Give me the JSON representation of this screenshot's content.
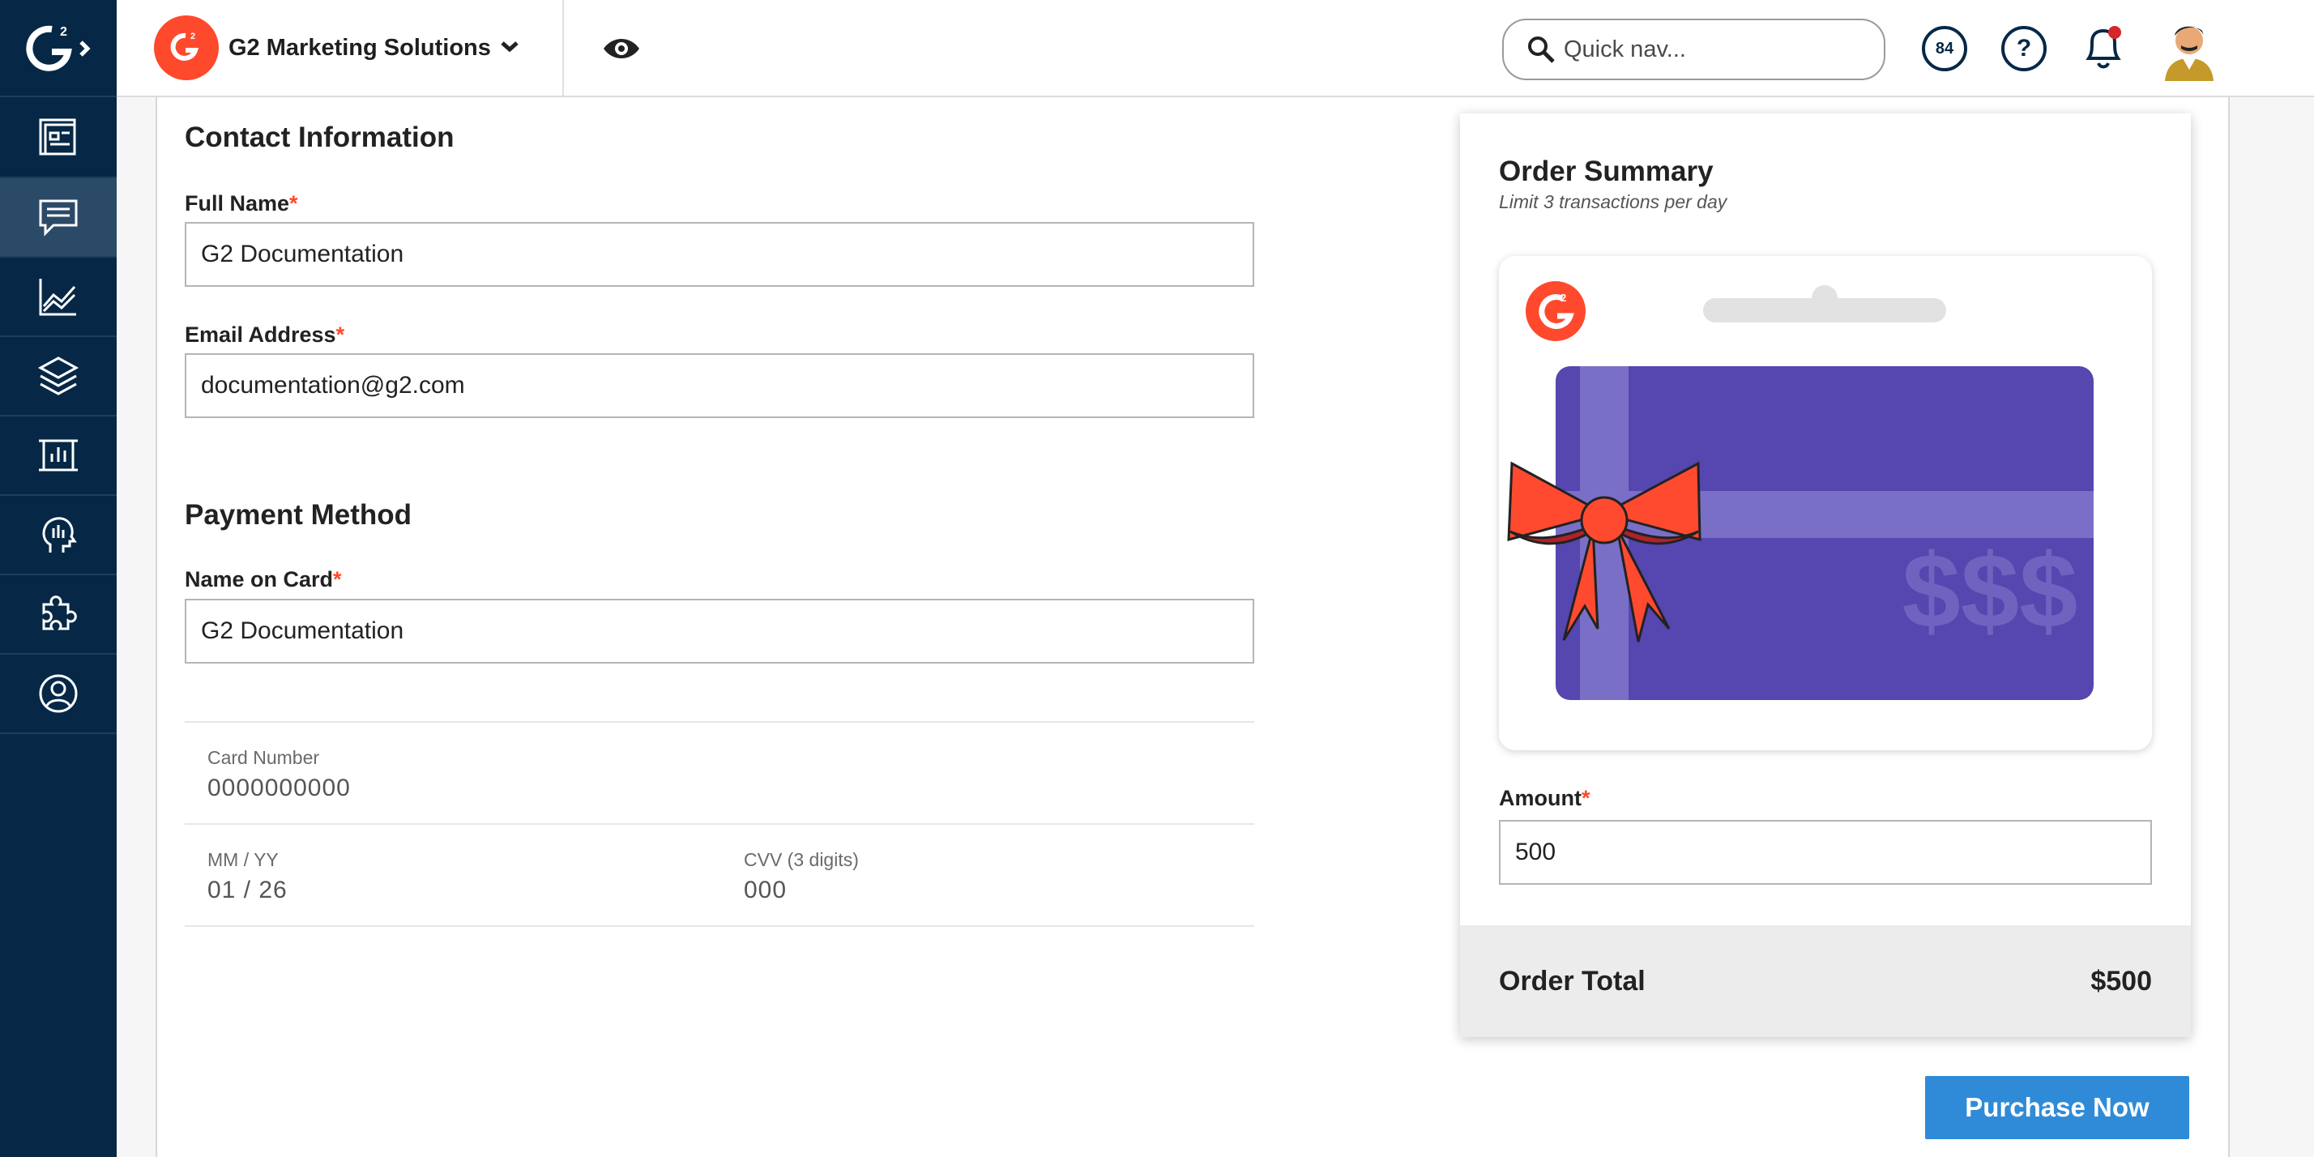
{
  "brand": {
    "accent": "#ff492c",
    "navy": "#062846",
    "button_blue": "#2f8bd7"
  },
  "topbar": {
    "company_name": "G2 Marketing Solutions",
    "search_placeholder": "Quick nav...",
    "score": "84",
    "help": "?"
  },
  "sidebar": {
    "items": [
      {
        "icon": "dashboard-icon"
      },
      {
        "icon": "reviews-chat-icon",
        "active": true
      },
      {
        "icon": "analytics-chart-icon"
      },
      {
        "icon": "layers-icon"
      },
      {
        "icon": "report-frame-icon"
      },
      {
        "icon": "buyer-intent-head-icon"
      },
      {
        "icon": "integrations-puzzle-icon"
      },
      {
        "icon": "profile-icon"
      }
    ]
  },
  "contact": {
    "title": "Contact Information",
    "full_name_label": "Full Name",
    "full_name_value": "G2 Documentation",
    "email_label": "Email Address",
    "email_value": "documentation@g2.com"
  },
  "payment": {
    "title": "Payment Method",
    "name_on_card_label": "Name on Card",
    "name_on_card_value": "G2 Documentation",
    "card_number_label": "Card Number",
    "card_number_placeholder": "0000000000",
    "expiry_label": "MM / YY",
    "expiry_placeholder": "01 / 26",
    "cvv_label": "CVV (3 digits)",
    "cvv_placeholder": "000"
  },
  "required_mark": "*",
  "summary": {
    "title": "Order Summary",
    "subtitle": "Limit 3 transactions per day",
    "gift_card_symbol": "$$$",
    "amount_label": "Amount",
    "amount_value": "500",
    "total_label": "Order Total",
    "total_value": "$500"
  },
  "purchase_button": "Purchase Now"
}
